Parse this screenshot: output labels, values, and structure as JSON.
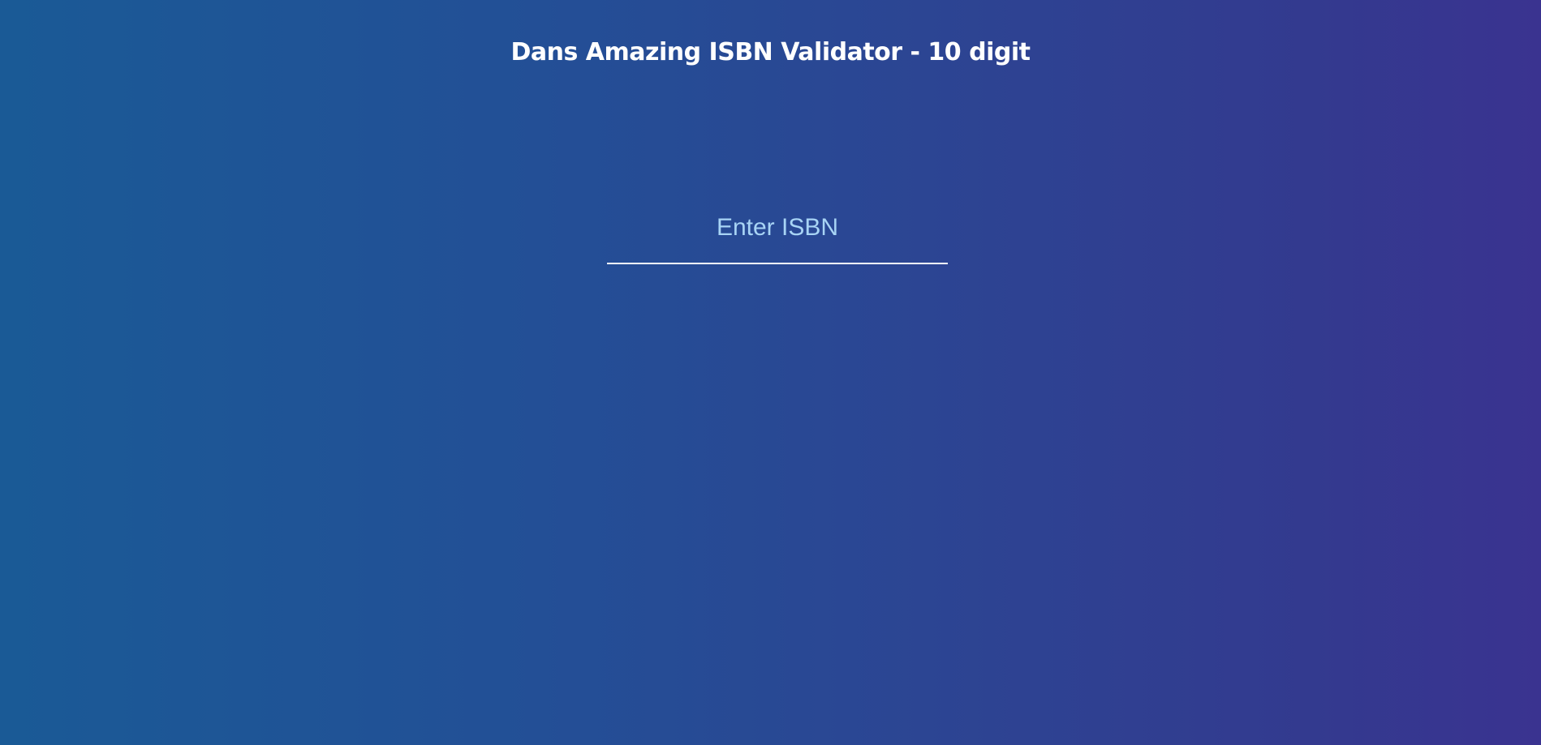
{
  "header": {
    "title": "Dans Amazing ISBN Validator - 10 digit"
  },
  "form": {
    "isbn_input": {
      "value": "",
      "placeholder": "Enter ISBN"
    }
  },
  "colors": {
    "background_gradient_start": "#1a5a96",
    "background_gradient_end": "#3a3390",
    "title_text": "#ffffff",
    "placeholder_text": "#a8d4f5",
    "input_underline": "#ffffff"
  }
}
